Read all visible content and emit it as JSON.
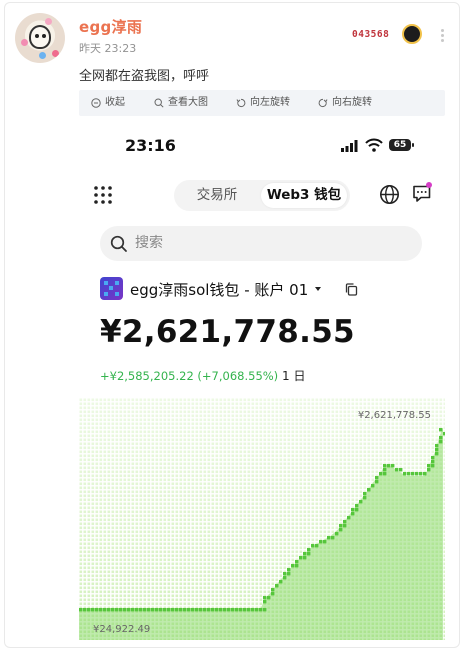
{
  "post": {
    "username": "egg淳雨",
    "time": "昨天 23:23",
    "badge_number": "043568",
    "text": "全网都在盗我图，呼呼"
  },
  "toolbar": {
    "collapse": "收起",
    "view_large": "查看大图",
    "rotate_left": "向左旋转",
    "rotate_right": "向右旋转"
  },
  "screenshot": {
    "status_time": "23:16",
    "battery": "65",
    "tabs": [
      "交易所",
      "Web3 钱包"
    ],
    "search_placeholder": "搜索",
    "wallet_name": "egg淳雨sol钱包 - 账户 01",
    "balance": "¥2,621,778.55",
    "change": "+¥2,585,205.22 (+7,068.55%)",
    "period": "1 日",
    "icons": [
      "grid-icon",
      "globe-icon",
      "chat-icon",
      "search-icon",
      "copy-icon"
    ],
    "accent_color": "#34b34d"
  },
  "chart_data": {
    "type": "area",
    "max_label": "¥2,621,778.55",
    "min_label": "¥24,922.49",
    "color": "#56c63c",
    "points": [
      [
        0,
        24922
      ],
      [
        50,
        24922
      ],
      [
        51,
        150000
      ],
      [
        53,
        270000
      ],
      [
        55,
        410000
      ],
      [
        57,
        530000
      ],
      [
        59,
        650000
      ],
      [
        61,
        760000
      ],
      [
        63,
        860000
      ],
      [
        65,
        940000
      ],
      [
        67,
        1000000
      ],
      [
        69,
        1060000
      ],
      [
        71,
        1150000
      ],
      [
        73,
        1280000
      ],
      [
        75,
        1420000
      ],
      [
        77,
        1560000
      ],
      [
        79,
        1700000
      ],
      [
        81,
        1850000
      ],
      [
        83,
        1980000
      ],
      [
        84,
        2100000
      ],
      [
        86,
        2060000
      ],
      [
        88,
        1990000
      ],
      [
        90,
        1930000
      ],
      [
        93,
        1930000
      ],
      [
        95,
        1930000
      ],
      [
        96,
        2050000
      ],
      [
        98,
        2300000
      ],
      [
        99,
        2500000
      ],
      [
        100,
        2621778
      ]
    ]
  }
}
